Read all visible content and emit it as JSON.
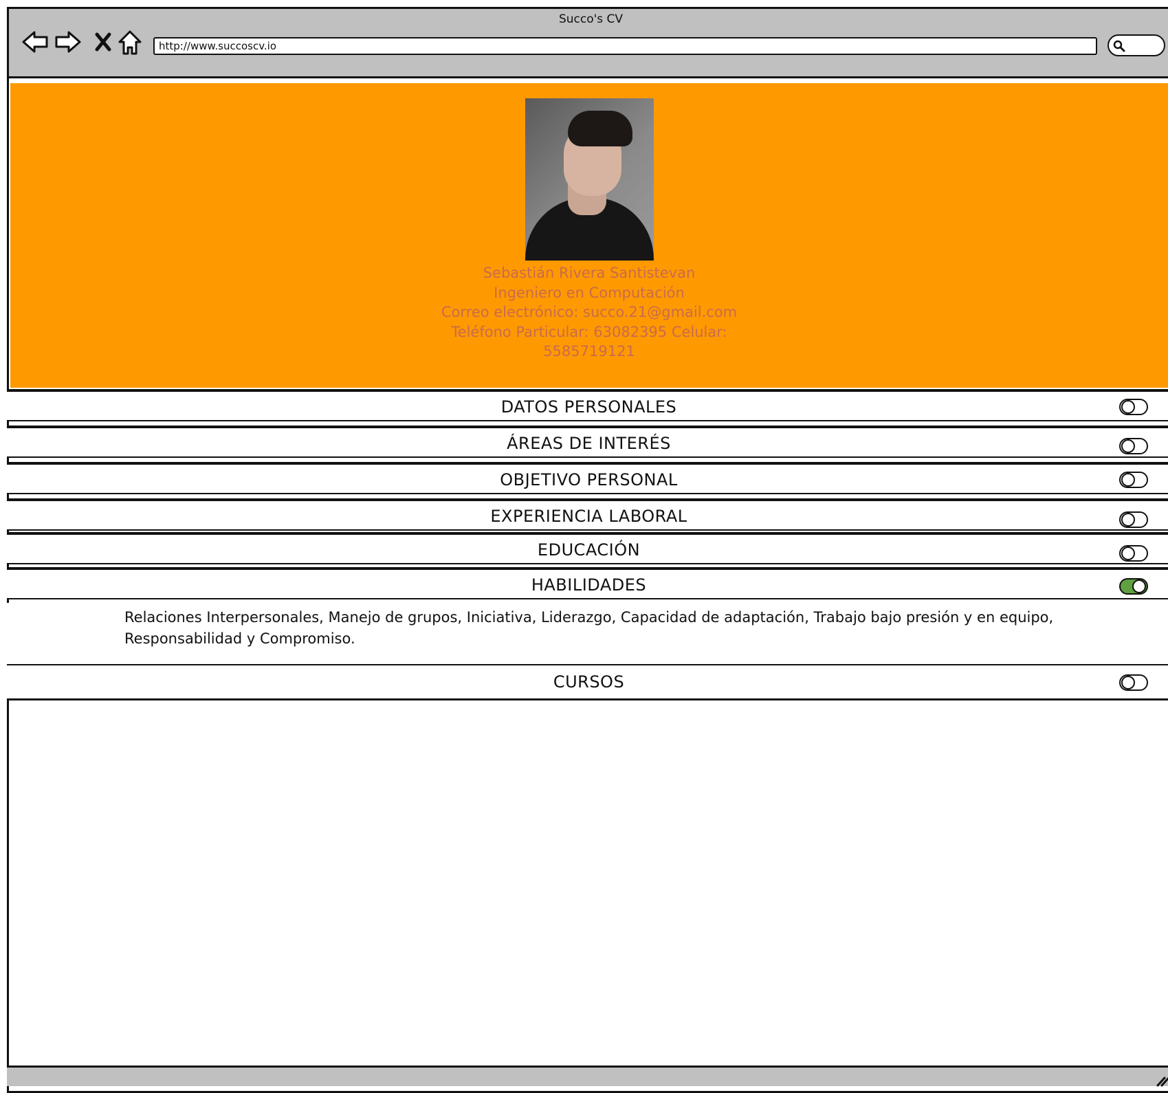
{
  "browser": {
    "title": "Succo's CV",
    "url": "http://www.succoscv.io",
    "nav_icons": [
      "back-arrow-icon",
      "forward-arrow-icon",
      "close-x-icon",
      "home-icon"
    ]
  },
  "profile": {
    "name": "Sebastián Rivera Santistevan",
    "profession": "Ingeniero en Computación",
    "email_line": "Correo electrónico: succo.21@gmail.com",
    "phone_line": "Teléfono Particular: 63082395 Celular:",
    "mobile_line": "5585719121",
    "header_color": "#ff9900",
    "text_color": "#c96b4d"
  },
  "sections": [
    {
      "label": "DATOS PERSONALES",
      "expanded": false
    },
    {
      "label": "ÁREAS DE INTERÉS",
      "expanded": false
    },
    {
      "label": "OBJETIVO PERSONAL",
      "expanded": false
    },
    {
      "label": "EXPERIENCIA LABORAL",
      "expanded": false
    },
    {
      "label": "EDUCACIÓN",
      "expanded": false
    },
    {
      "label": "HABILIDADES",
      "expanded": true
    },
    {
      "label": "CURSOS",
      "expanded": false
    }
  ],
  "skills_text": "Relaciones Interpersonales, Manejo de grupos, Iniciativa, Liderazgo, Capacidad de adaptación, Trabajo bajo presión y en equipo, Responsabilidad y Compromiso.",
  "toggle_on_color": "#60a040"
}
